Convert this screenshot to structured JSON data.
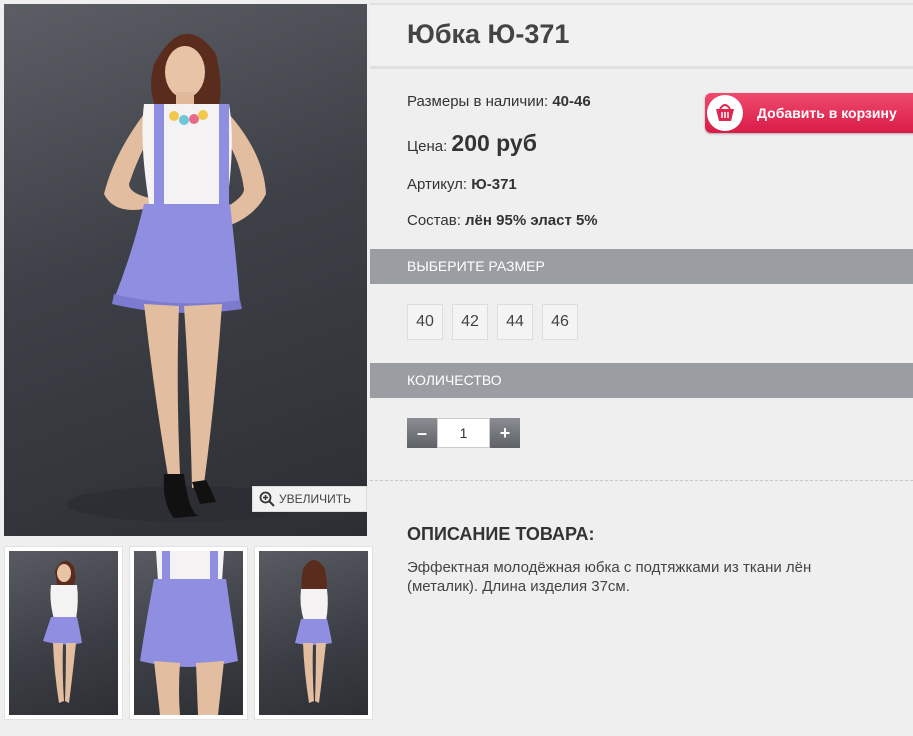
{
  "product": {
    "title": "Юбка Ю-371",
    "sizes_label": "Размеры в наличии:",
    "sizes_value": "40-46",
    "price_label": "Цена:",
    "price_value": "200 руб",
    "sku_label": "Артикул:",
    "sku_value": "Ю-371",
    "composition_label": "Состав:",
    "composition_value": "лён 95% эласт 5%"
  },
  "cart_button": {
    "label": "Добавить в корзину",
    "icon": "basket-icon",
    "color": "#e0264f"
  },
  "gallery": {
    "zoom_label": "УВЕЛИЧИТЬ",
    "zoom_icon": "magnifier-plus-icon"
  },
  "size_section": {
    "title": "ВЫБЕРИТЕ РАЗМЕР",
    "options": [
      "40",
      "42",
      "44",
      "46"
    ]
  },
  "quantity_section": {
    "title": "КОЛИЧЕСТВО",
    "value": "1",
    "minus": "–",
    "plus": "+"
  },
  "description": {
    "title": "ОПИСАНИЕ ТОВАРА:",
    "text": "Эффектная молодёжная юбка с подтяжками из ткани лён (металик). Длина изделия 37см."
  },
  "colors": {
    "skirt": "#8f8ee0",
    "bar": "#9a9ea3",
    "accent": "#e0264f"
  }
}
